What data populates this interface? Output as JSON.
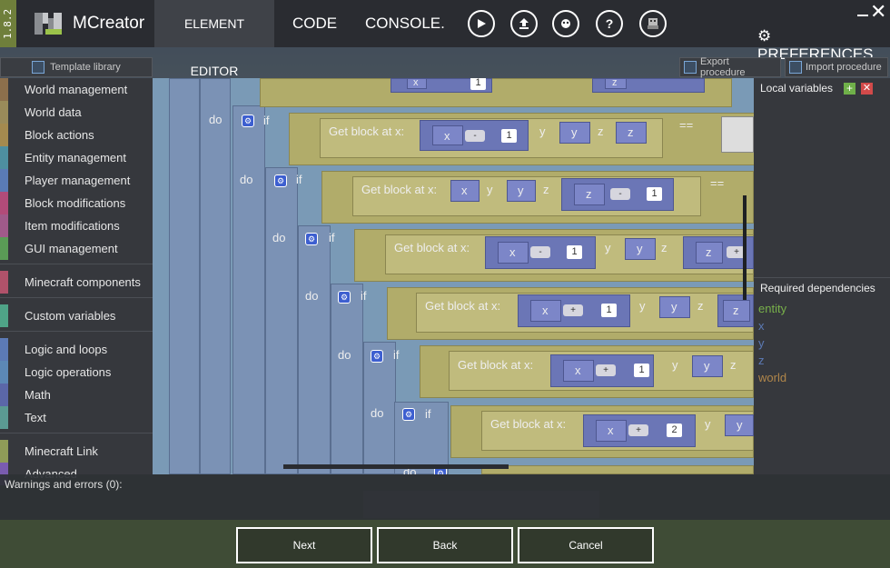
{
  "app": {
    "version": "1.8.2",
    "title": "MCreator"
  },
  "tabs": [
    {
      "label": "ELEMENT EDITOR"
    },
    {
      "label": "CODE"
    },
    {
      "label": "CONSOLE."
    }
  ],
  "toolbar_icons": [
    "run-icon",
    "export-icon",
    "bug-icon",
    "help-icon",
    "mob-icon"
  ],
  "preferences_label": "PREFERENCES",
  "template_library": "Template library",
  "export_procedure": "Export procedure",
  "import_procedure": "Import procedure",
  "palette": {
    "groups": [
      [
        {
          "label": "World management",
          "color": "#8c6f4c"
        },
        {
          "label": "World data",
          "color": "#9a8b5a"
        },
        {
          "label": "Block actions",
          "color": "#a48a4f"
        },
        {
          "label": "Entity management",
          "color": "#4e8fa0"
        },
        {
          "label": "Player management",
          "color": "#5a7bb5"
        },
        {
          "label": "Block modifications",
          "color": "#b24b79"
        },
        {
          "label": "Item modifications",
          "color": "#a05a8a"
        },
        {
          "label": "GUI management",
          "color": "#5a9b56"
        }
      ],
      [
        {
          "label": "Minecraft components",
          "color": "#b0526a"
        }
      ],
      [
        {
          "label": "Custom variables",
          "color": "#4fa387"
        }
      ],
      [
        {
          "label": "Logic and loops",
          "color": "#5c7ab5"
        },
        {
          "label": "Logic operations",
          "color": "#5c88b5"
        },
        {
          "label": "Math",
          "color": "#5b67a8"
        },
        {
          "label": "Text",
          "color": "#5b9a93"
        }
      ],
      [
        {
          "label": "Minecraft Link",
          "color": "#8f9b58"
        },
        {
          "label": "Advanced",
          "color": "#7a5bb0"
        }
      ]
    ]
  },
  "workspace": {
    "rows": [
      {
        "do": "do",
        "if": "if",
        "get": "Get block at x:",
        "x": "x",
        "op": "-",
        "n": "1",
        "y": "y",
        "z": "z",
        "eq": "=="
      },
      {
        "do": "do",
        "if": "if",
        "get": "Get block at x:",
        "x": "x",
        "y": "y",
        "z": "z",
        "op": "-",
        "n": "1",
        "eq": "=="
      },
      {
        "do": "do",
        "if": "if",
        "get": "Get block at x:",
        "x": "x",
        "op": "-",
        "n": "1",
        "y": "y",
        "z": "z",
        "zop": "+"
      },
      {
        "do": "do",
        "if": "if",
        "get": "Get block at x:",
        "x": "x",
        "op": "+",
        "n": "1",
        "y": "y",
        "z": "z"
      },
      {
        "do": "do",
        "if": "if",
        "get": "Get block at x:",
        "x": "x",
        "op": "+",
        "n": "1",
        "y": "y",
        "z": "z"
      },
      {
        "do": "do",
        "if": "if",
        "get": "Get block at x:",
        "x": "x",
        "op": "+",
        "n": "2",
        "y": "y"
      }
    ],
    "top_partial": {
      "x": "x",
      "n": "1",
      "z": "z"
    },
    "bottom_partial": {
      "do": "do"
    }
  },
  "local_variables": "Local variables",
  "required_dependencies": {
    "title": "Required dependencies",
    "items": [
      {
        "label": "entity",
        "color": "#78b04a"
      },
      {
        "label": "x",
        "color": "#5c7ab5"
      },
      {
        "label": "y",
        "color": "#5c7ab5"
      },
      {
        "label": "z",
        "color": "#5c7ab5"
      },
      {
        "label": "world",
        "color": "#b0864a"
      }
    ]
  },
  "warnings": "Warnings and errors (0):",
  "buttons": {
    "next": "Next",
    "back": "Back",
    "cancel": "Cancel"
  }
}
